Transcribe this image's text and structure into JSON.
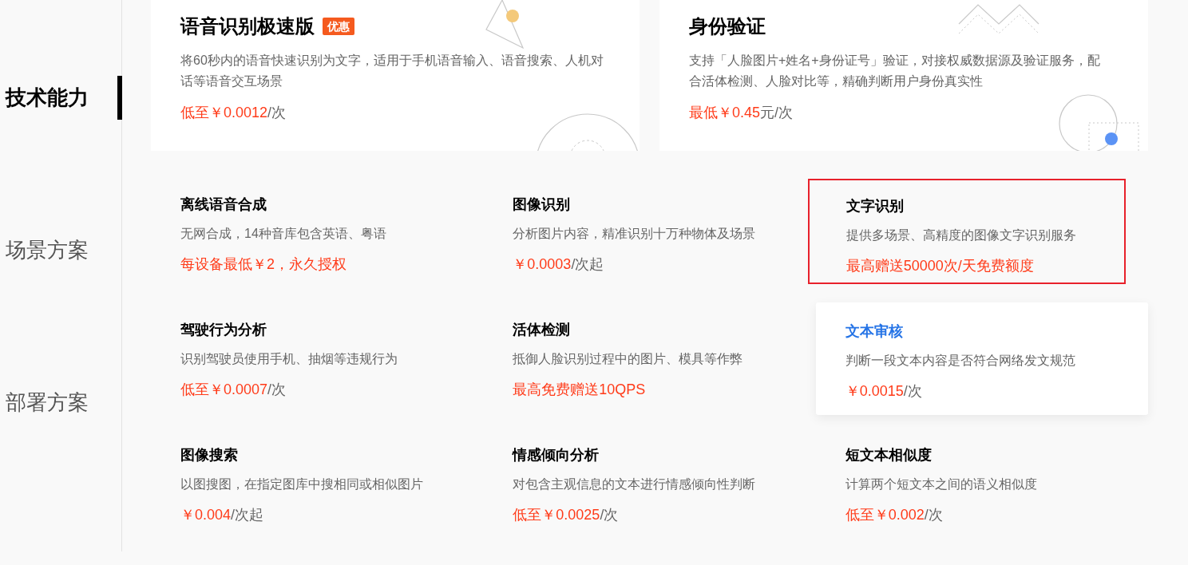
{
  "sidebar": {
    "items": [
      {
        "label": "技术能力",
        "selected": true
      },
      {
        "label": "场景方案",
        "selected": false
      },
      {
        "label": "部署方案",
        "selected": false
      }
    ]
  },
  "featured": [
    {
      "title": "语音识别极速版",
      "badge": "优惠",
      "description": "将60秒内的语音快速识别为文字，适用于手机语音输入、语音搜索、人机对话等语音交互场景",
      "price": "低至￥0.0012",
      "unit": "/次",
      "kind": "triangle"
    },
    {
      "title": "身份验证",
      "description": "支持「人脸图片+姓名+身份证号」验证，对接权威数据源及验证服务，配合活体检测、人脸对比等，精确判断用户身份真实性",
      "price": "最低￥0.45",
      "unit": "元/次",
      "kind": "zigzag"
    }
  ],
  "products": [
    {
      "title": "离线语音合成",
      "description": "无网合成，14种音库包含英语、粤语",
      "price": "每设备最低￥2，永久授权",
      "hovered": false,
      "outlined": false
    },
    {
      "title": "图像识别",
      "description": "分析图片内容，精准识别十万种物体及场景",
      "price": "￥0.0003",
      "unit": "/次起",
      "hovered": false,
      "outlined": false
    },
    {
      "title": "文字识别",
      "description": "提供多场景、高精度的图像文字识别服务",
      "price": "最高赠送50000次/天免费额度",
      "hovered": false,
      "outlined": true
    },
    {
      "title": "驾驶行为分析",
      "description": "识别驾驶员使用手机、抽烟等违规行为",
      "price": "低至￥0.0007",
      "unit": "/次",
      "hovered": false,
      "outlined": false
    },
    {
      "title": "活体检测",
      "description": "抵御人脸识别过程中的图片、模具等作弊",
      "price": "最高免费赠送10QPS",
      "hovered": false,
      "outlined": false
    },
    {
      "title": "文本审核",
      "description": "判断一段文本内容是否符合网络发文规范",
      "price": "￥0.0015",
      "unit": "/次",
      "hovered": true,
      "outlined": false
    },
    {
      "title": "图像搜索",
      "description": "以图搜图，在指定图库中搜相同或相似图片",
      "price": "￥0.004",
      "unit": "/次起",
      "hovered": false,
      "outlined": false
    },
    {
      "title": "情感倾向分析",
      "description": "对包含主观信息的文本进行情感倾向性判断",
      "price": "低至￥0.0025",
      "unit": "/次",
      "hovered": false,
      "outlined": false
    },
    {
      "title": "短文本相似度",
      "description": "计算两个短文本之间的语义相似度",
      "price": "低至￥0.002",
      "unit": "/次",
      "hovered": false,
      "outlined": false
    }
  ]
}
